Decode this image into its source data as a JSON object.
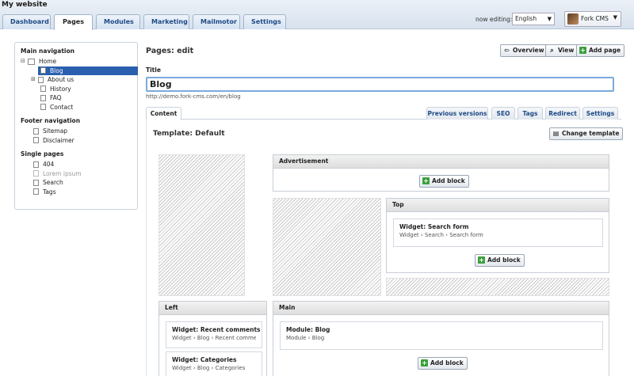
{
  "app": {
    "site_title": "My website"
  },
  "tabs": [
    "Dashboard",
    "Pages",
    "Modules",
    "Marketing",
    "Mailmotor",
    "Settings"
  ],
  "header": {
    "editing_label": "now editing:",
    "language": "English",
    "user": "Fork CMS"
  },
  "sidebar": {
    "main_heading": "Main navigation",
    "main_items": [
      "Home",
      "Blog",
      "About us",
      "History",
      "FAQ",
      "Contact"
    ],
    "footer_heading": "Footer navigation",
    "footer_items": [
      "Sitemap",
      "Disclaimer"
    ],
    "single_heading": "Single pages",
    "single_items": [
      "404",
      "Lorem ipsum",
      "Search",
      "Tags"
    ]
  },
  "page": {
    "heading": "Pages: edit",
    "buttons": {
      "overview": "Overview",
      "view": "View",
      "add_page": "Add page"
    },
    "title_label": "Title",
    "title_value": "Blog",
    "url": "http://demo.fork-cms.com/en/blog"
  },
  "content_tabs": [
    "Content",
    "Previous versions",
    "SEO",
    "Tags",
    "Redirect",
    "Settings"
  ],
  "template": {
    "title": "Template: Default",
    "change_button": "Change template",
    "add_block": "Add block",
    "blocks": {
      "advertisement": "Advertisement",
      "top": "Top",
      "left": "Left",
      "main": "Main"
    },
    "widgets": {
      "search_title": "Widget: Search form",
      "search_path": "Widget › Search › Search form",
      "recent_title": "Widget: Recent comments",
      "recent_path": "Widget › Blog › Recent comments",
      "cat_title": "Widget: Categories",
      "cat_path": "Widget › Blog › Categories",
      "blog_title": "Module: Blog",
      "blog_path": "Module › Blog"
    }
  },
  "colors": {
    "accent": "#2a5fb0",
    "tab_text": "#1e4a86",
    "add_icon": "#3c9f3c"
  }
}
